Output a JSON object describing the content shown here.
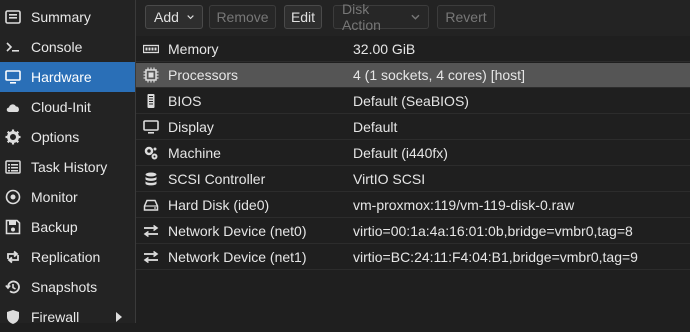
{
  "sidebar": {
    "items": [
      {
        "label": "Summary",
        "icon": "summary-icon"
      },
      {
        "label": "Console",
        "icon": "console-icon"
      },
      {
        "label": "Hardware",
        "icon": "monitor-icon",
        "active": true
      },
      {
        "label": "Cloud-Init",
        "icon": "cloud-icon"
      },
      {
        "label": "Options",
        "icon": "gear-icon"
      },
      {
        "label": "Task History",
        "icon": "list-icon"
      },
      {
        "label": "Monitor",
        "icon": "eye-icon"
      },
      {
        "label": "Backup",
        "icon": "floppy-icon"
      },
      {
        "label": "Replication",
        "icon": "retweet-icon"
      },
      {
        "label": "Snapshots",
        "icon": "history-icon"
      },
      {
        "label": "Firewall",
        "icon": "shield-icon"
      }
    ]
  },
  "toolbar": {
    "add_label": "Add",
    "remove_label": "Remove",
    "edit_label": "Edit",
    "disk_action_label": "Disk Action",
    "revert_label": "Revert"
  },
  "hardware": {
    "rows": [
      {
        "name": "Memory",
        "value": "32.00 GiB",
        "icon": "memory-icon"
      },
      {
        "name": "Processors",
        "value": "4 (1 sockets, 4 cores) [host]",
        "icon": "cpu-icon"
      },
      {
        "name": "BIOS",
        "value": "Default (SeaBIOS)",
        "icon": "bios-icon"
      },
      {
        "name": "Display",
        "value": "Default",
        "icon": "display-icon"
      },
      {
        "name": "Machine",
        "value": "Default (i440fx)",
        "icon": "machine-icon"
      },
      {
        "name": "SCSI Controller",
        "value": "VirtIO SCSI",
        "icon": "database-icon"
      },
      {
        "name": "Hard Disk (ide0)",
        "value": "vm-proxmox:119/vm-119-disk-0.raw",
        "icon": "harddisk-icon"
      },
      {
        "name": "Network Device (net0)",
        "value": "virtio=00:1a:4a:16:01:0b,bridge=vmbr0,tag=8",
        "icon": "network-icon"
      },
      {
        "name": "Network Device (net1)",
        "value": "virtio=BC:24:11:F4:04:B1,bridge=vmbr0,tag=9",
        "icon": "network-icon"
      }
    ]
  },
  "colors": {
    "accent": "#2a6fb7",
    "selected_row": "#555555",
    "background": "#1f1f1f"
  }
}
